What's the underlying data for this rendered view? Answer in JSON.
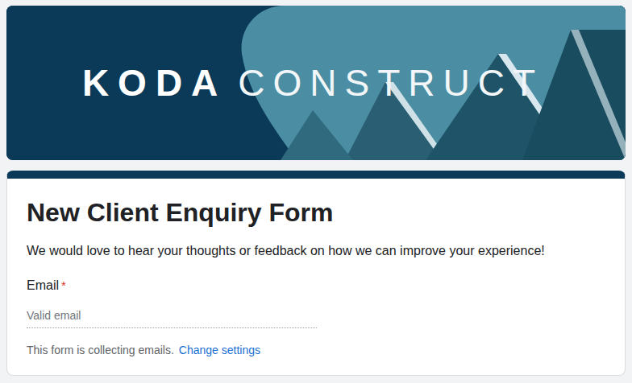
{
  "banner": {
    "logo_bold": "KODA",
    "logo_light": "CONSTRUCT"
  },
  "form": {
    "title": "New Client Enquiry Form",
    "description": "We would love to hear your thoughts or feedback on how we can improve your experience!",
    "fields": [
      {
        "label": "Email",
        "required": true,
        "required_mark": "*",
        "placeholder": "Valid email"
      }
    ],
    "notice": "This form is collecting emails.",
    "notice_link": "Change settings"
  }
}
